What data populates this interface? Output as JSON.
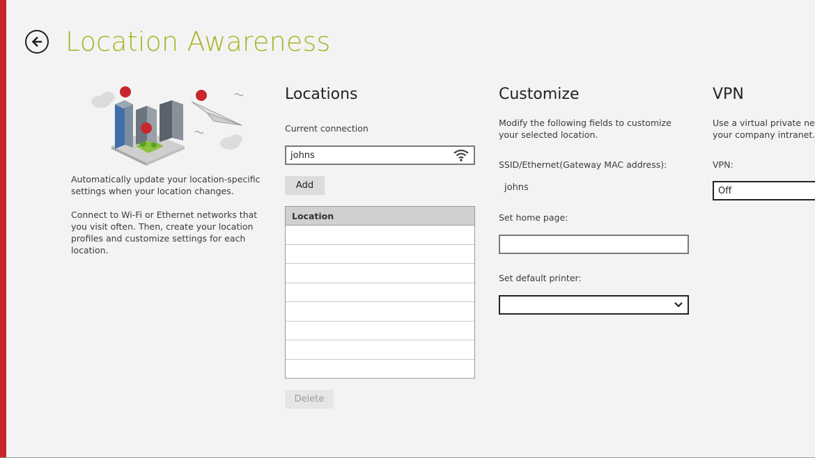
{
  "page": {
    "title": "Location Awareness",
    "accent_color": "#c8262d",
    "title_color": "#a8b325"
  },
  "intro": {
    "paragraph1": "Automatically update your location-specific settings when your location changes.",
    "paragraph2": "Connect to Wi-Fi or Ethernet networks that you visit often. Then, create your location profiles and customize settings for each location."
  },
  "locations": {
    "title": "Locations",
    "current_connection_label": "Current connection",
    "current_connection_value": "johns",
    "add_label": "Add",
    "table_header": "Location",
    "rows": [
      "",
      "",
      "",
      "",
      "",
      "",
      "",
      ""
    ],
    "delete_label": "Delete"
  },
  "customize": {
    "title": "Customize",
    "description": "Modify the following fields to customize your selected location.",
    "ssid_label": "SSID/Ethernet(Gateway MAC address):",
    "ssid_value": "johns",
    "home_page_label": "Set home page:",
    "home_page_value": "",
    "printer_label": "Set default printer:",
    "printer_value": ""
  },
  "vpn": {
    "title": "VPN",
    "description": "Use a virtual private network to access your company intranet.",
    "label": "VPN:",
    "value": "Off"
  },
  "icons": {
    "back": "back-arrow-icon",
    "wifi": "wifi-icon",
    "dropdown": "chevron-down-icon"
  }
}
